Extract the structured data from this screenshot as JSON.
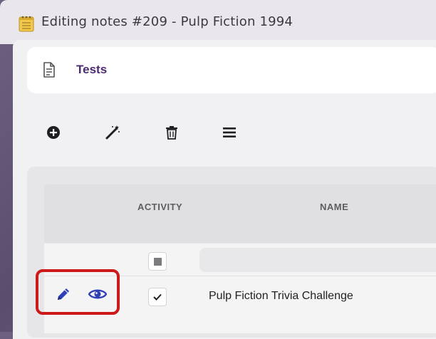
{
  "window": {
    "title": "Editing notes #209 - Pulp Fiction 1994",
    "title_icon": "notepad-icon"
  },
  "header": {
    "title": "Tests",
    "icon": "document-icon",
    "title_color": "#4b2a72"
  },
  "toolbar": {
    "buttons": [
      {
        "name": "add",
        "icon": "plus-circle-icon"
      },
      {
        "name": "generate",
        "icon": "magic-wand-icon"
      },
      {
        "name": "delete",
        "icon": "trash-icon"
      },
      {
        "name": "menu",
        "icon": "hamburger-menu-icon"
      }
    ]
  },
  "table": {
    "columns": [
      "ACTIVITY",
      "NAME"
    ],
    "filter_row": {
      "activity_state": "indeterminate",
      "name_filter": ""
    },
    "rows": [
      {
        "actions": [
          {
            "icon": "pencil-icon",
            "color": "#2f3fb5"
          },
          {
            "icon": "eye-icon",
            "color": "#2f3fb5"
          }
        ],
        "activity_checked": true,
        "name": "Pulp Fiction Trivia Challenge"
      }
    ]
  },
  "highlight_color": "#cc1a1a"
}
